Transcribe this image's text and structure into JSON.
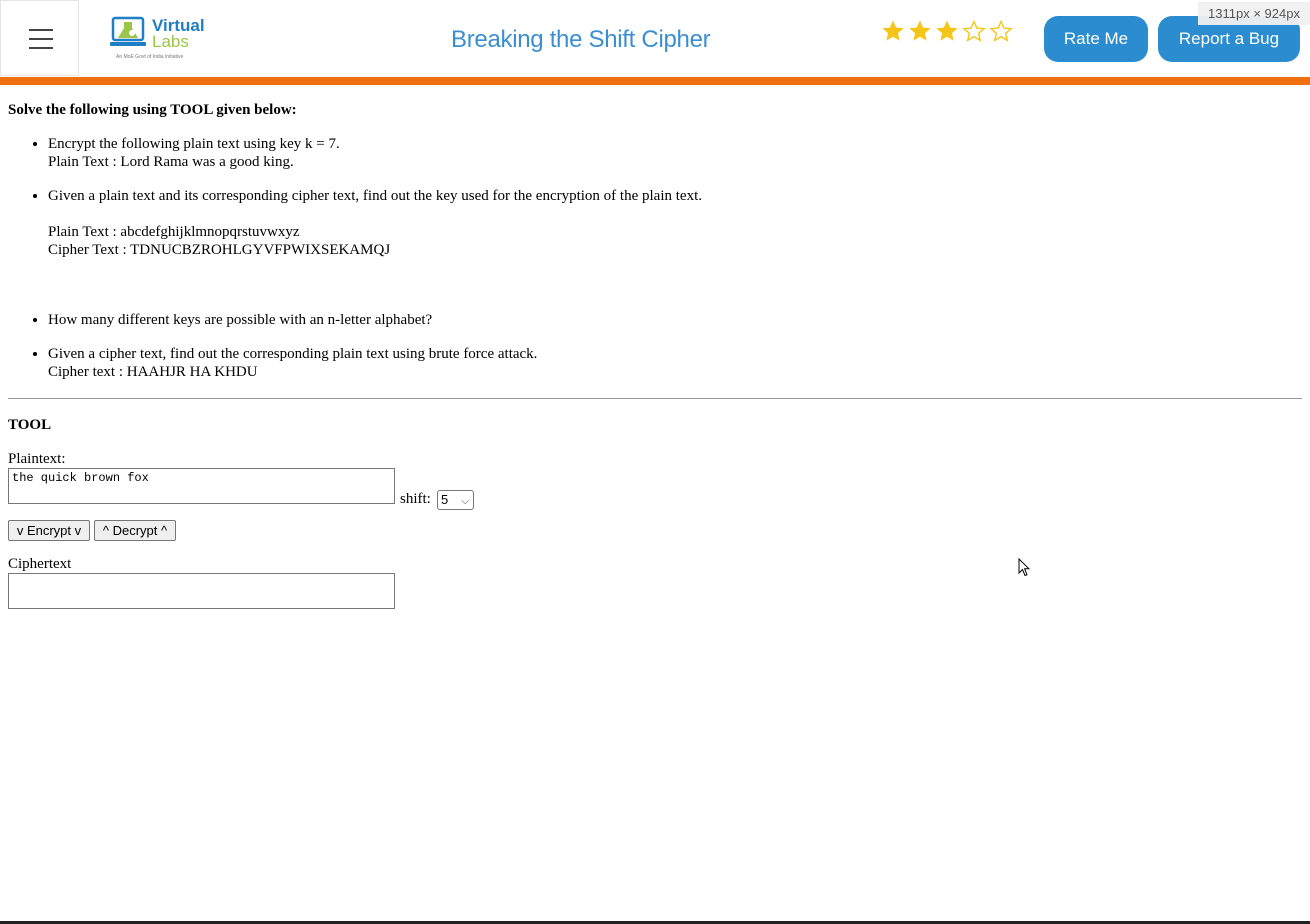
{
  "header": {
    "logo": {
      "word1": "Virtual",
      "word2": "Labs",
      "tagline": "An MoE Govt of India Initiative"
    },
    "title": "Breaking the Shift Cipher",
    "rating": {
      "filled": 3,
      "total": 5
    },
    "rate_button": "Rate Me",
    "bug_button": "Report a Bug",
    "size_badge": "1311px × 924px",
    "colors": {
      "accent": "#2b8ccf",
      "title": "#3b8fd0",
      "bar": "#f06f0e",
      "star": "#f5c518"
    }
  },
  "exercise": {
    "heading": "Solve the following using TOOL given below:",
    "q1": {
      "line1": "Encrypt the following plain text using key k = 7.",
      "line2": "Plain Text : Lord Rama was a good king."
    },
    "q2": {
      "line1": "Given a plain text and its corresponding cipher text, find out the key used for the encryption of the plain text.",
      "plain": "Plain Text : abcdefghijklmnopqrstuvwxyz",
      "cipher": "Cipher Text : TDNUCBZROHLGYVFPWIXSEKAMQJ"
    },
    "q3": {
      "line1": "How many different keys are possible with an n-letter alphabet?"
    },
    "q4": {
      "line1": "Given a cipher text, find out the corresponding plain text using brute force attack.",
      "cipher": "Cipher text : HAAHJR HA KHDU"
    }
  },
  "tool": {
    "heading": "TOOL",
    "plaintext_label": "Plaintext:",
    "plaintext_value": "the quick brown fox",
    "shift_label": "shift:",
    "shift_value": "5",
    "encrypt_button": "v Encrypt v",
    "decrypt_button": "^ Decrypt ^",
    "ciphertext_label": "Ciphertext",
    "ciphertext_value": ""
  }
}
